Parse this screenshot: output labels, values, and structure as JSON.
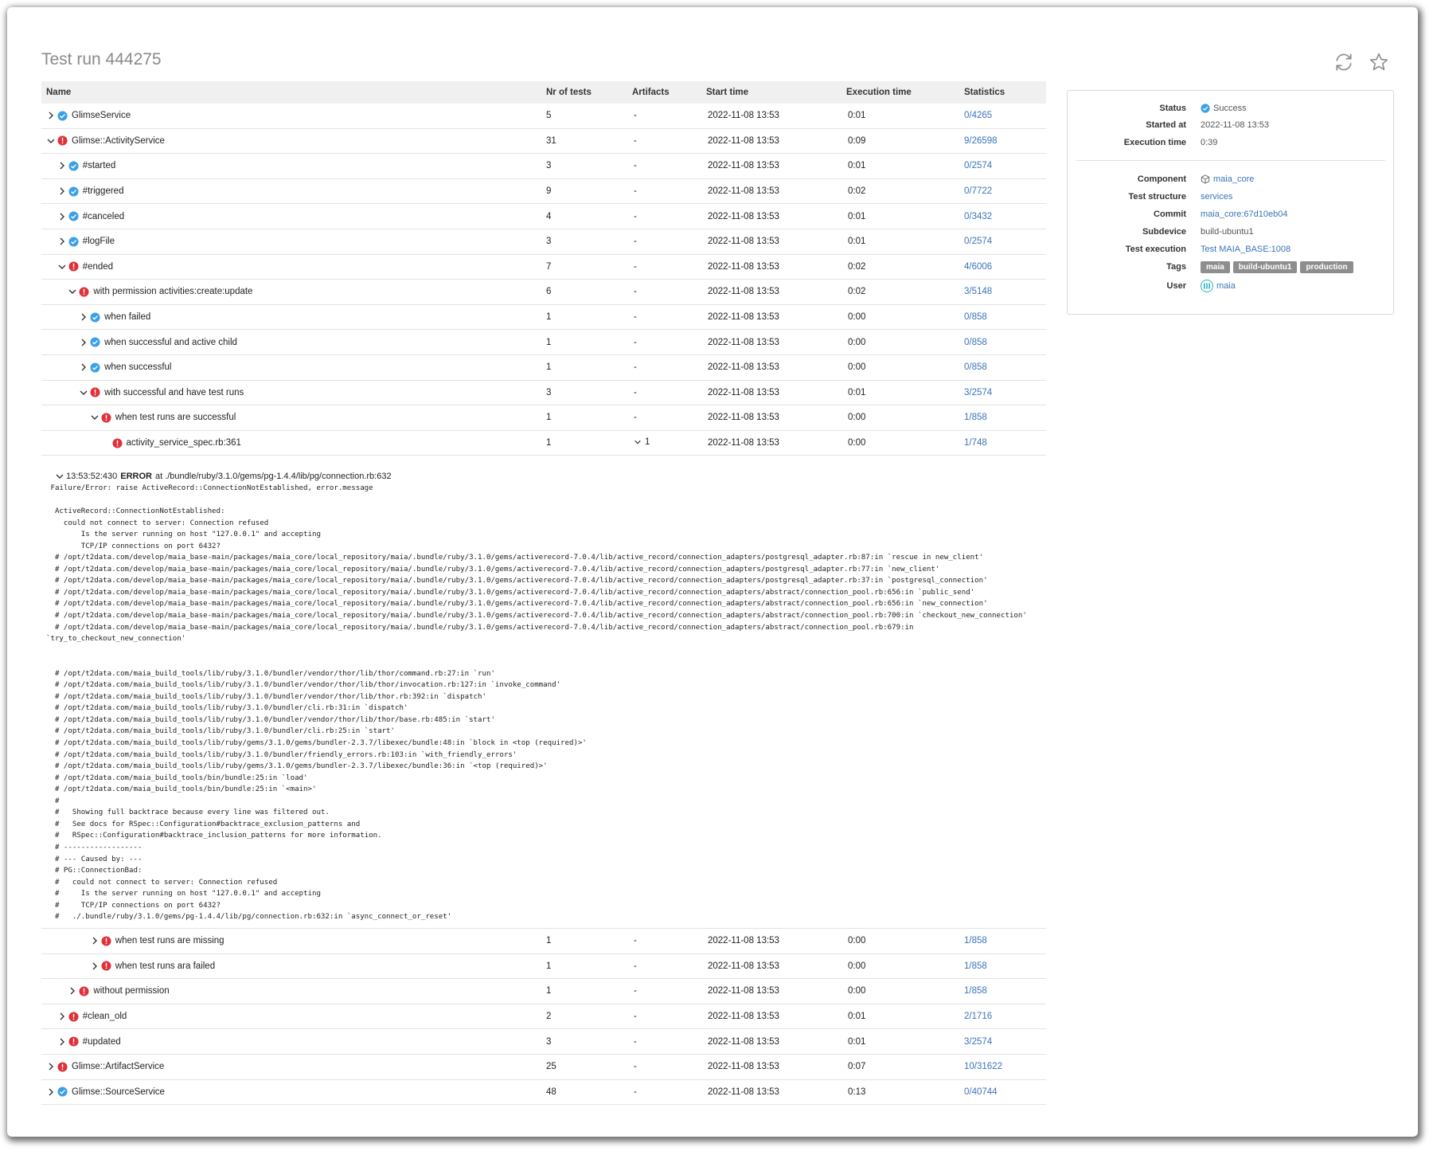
{
  "page": {
    "title": "Test run 444275"
  },
  "icons": {
    "refresh": "refresh-icon",
    "favorite": "star-icon"
  },
  "colors": {
    "success": "#3aa0e8",
    "error": "#e0313a",
    "link": "#3a74b8",
    "tag": "#8e8e8e"
  },
  "table": {
    "headers": {
      "name": "Name",
      "nr": "Nr of tests",
      "artifacts": "Artifacts",
      "start": "Start time",
      "exec": "Execution time",
      "stats": "Statistics"
    },
    "rows": [
      {
        "name": "GlimseService",
        "nr": "5",
        "artifacts": "-",
        "start": "2022-11-08 13:53",
        "exec": "0:01",
        "stats": "0/4265"
      },
      {
        "name": "Glimse::ActivityService",
        "nr": "31",
        "artifacts": "-",
        "start": "2022-11-08 13:53",
        "exec": "0:09",
        "stats": "9/26598"
      },
      {
        "name": "#started",
        "nr": "3",
        "artifacts": "-",
        "start": "2022-11-08 13:53",
        "exec": "0:01",
        "stats": "0/2574"
      },
      {
        "name": "#triggered",
        "nr": "9",
        "artifacts": "-",
        "start": "2022-11-08 13:53",
        "exec": "0:02",
        "stats": "0/7722"
      },
      {
        "name": "#canceled",
        "nr": "4",
        "artifacts": "-",
        "start": "2022-11-08 13:53",
        "exec": "0:01",
        "stats": "0/3432"
      },
      {
        "name": "#logFile",
        "nr": "3",
        "artifacts": "-",
        "start": "2022-11-08 13:53",
        "exec": "0:01",
        "stats": "0/2574"
      },
      {
        "name": "#ended",
        "nr": "7",
        "artifacts": "-",
        "start": "2022-11-08 13:53",
        "exec": "0:02",
        "stats": "4/6006"
      },
      {
        "name": "with permission activities:create:update",
        "nr": "6",
        "artifacts": "-",
        "start": "2022-11-08 13:53",
        "exec": "0:02",
        "stats": "3/5148"
      },
      {
        "name": "when failed",
        "nr": "1",
        "artifacts": "-",
        "start": "2022-11-08 13:53",
        "exec": "0:00",
        "stats": "0/858"
      },
      {
        "name": "when successful and active child",
        "nr": "1",
        "artifacts": "-",
        "start": "2022-11-08 13:53",
        "exec": "0:00",
        "stats": "0/858"
      },
      {
        "name": "when successful",
        "nr": "1",
        "artifacts": "-",
        "start": "2022-11-08 13:53",
        "exec": "0:00",
        "stats": "0/858"
      },
      {
        "name": "with successful and have test runs",
        "nr": "3",
        "artifacts": "-",
        "start": "2022-11-08 13:53",
        "exec": "0:01",
        "stats": "3/2574"
      },
      {
        "name": "when test runs are successful",
        "nr": "1",
        "artifacts": "-",
        "start": "2022-11-08 13:53",
        "exec": "0:00",
        "stats": "1/858"
      },
      {
        "name": "activity_service_spec.rb:361",
        "nr": "1",
        "artifacts": "1",
        "start": "2022-11-08 13:53",
        "exec": "0:00",
        "stats": "1/748"
      }
    ],
    "rows_after": [
      {
        "name": "when test runs are missing",
        "nr": "1",
        "artifacts": "-",
        "start": "2022-11-08 13:53",
        "exec": "0:00",
        "stats": "1/858"
      },
      {
        "name": "when test runs ara failed",
        "nr": "1",
        "artifacts": "-",
        "start": "2022-11-08 13:53",
        "exec": "0:00",
        "stats": "1/858"
      },
      {
        "name": "without permission",
        "nr": "1",
        "artifacts": "-",
        "start": "2022-11-08 13:53",
        "exec": "0:00",
        "stats": "1/858"
      },
      {
        "name": "#clean_old",
        "nr": "2",
        "artifacts": "-",
        "start": "2022-11-08 13:53",
        "exec": "0:01",
        "stats": "2/1716"
      },
      {
        "name": "#updated",
        "nr": "3",
        "artifacts": "-",
        "start": "2022-11-08 13:53",
        "exec": "0:01",
        "stats": "3/2574"
      },
      {
        "name": "Glimse::ArtifactService",
        "nr": "25",
        "artifacts": "-",
        "start": "2022-11-08 13:53",
        "exec": "0:07",
        "stats": "10/31622"
      },
      {
        "name": "Glimse::SourceService",
        "nr": "48",
        "artifacts": "-",
        "start": "2022-11-08 13:53",
        "exec": "0:13",
        "stats": "0/40744"
      }
    ]
  },
  "log": {
    "time": "13:53:52:430",
    "level": "ERROR",
    "location": "at ./bundle/ruby/3.1.0/gems/pg-1.4.4/lib/pg/connection.rb:632",
    "text": " Failure/Error: raise ActiveRecord::ConnectionNotEstablished, error.message\n\n  ActiveRecord::ConnectionNotEstablished:\n    could not connect to server: Connection refused\n        Is the server running on host \"127.0.0.1\" and accepting\n        TCP/IP connections on port 6432?\n  # /opt/t2data.com/develop/maia_base-main/packages/maia_core/local_repository/maia/.bundle/ruby/3.1.0/gems/activerecord-7.0.4/lib/active_record/connection_adapters/postgresql_adapter.rb:87:in `rescue in new_client'\n  # /opt/t2data.com/develop/maia_base-main/packages/maia_core/local_repository/maia/.bundle/ruby/3.1.0/gems/activerecord-7.0.4/lib/active_record/connection_adapters/postgresql_adapter.rb:77:in `new_client'\n  # /opt/t2data.com/develop/maia_base-main/packages/maia_core/local_repository/maia/.bundle/ruby/3.1.0/gems/activerecord-7.0.4/lib/active_record/connection_adapters/postgresql_adapter.rb:37:in `postgresql_connection'\n  # /opt/t2data.com/develop/maia_base-main/packages/maia_core/local_repository/maia/.bundle/ruby/3.1.0/gems/activerecord-7.0.4/lib/active_record/connection_adapters/abstract/connection_pool.rb:656:in `public_send'\n  # /opt/t2data.com/develop/maia_base-main/packages/maia_core/local_repository/maia/.bundle/ruby/3.1.0/gems/activerecord-7.0.4/lib/active_record/connection_adapters/abstract/connection_pool.rb:656:in `new_connection'\n  # /opt/t2data.com/develop/maia_base-main/packages/maia_core/local_repository/maia/.bundle/ruby/3.1.0/gems/activerecord-7.0.4/lib/active_record/connection_adapters/abstract/connection_pool.rb:700:in `checkout_new_connection'\n  # /opt/t2data.com/develop/maia_base-main/packages/maia_core/local_repository/maia/.bundle/ruby/3.1.0/gems/activerecord-7.0.4/lib/active_record/connection_adapters/abstract/connection_pool.rb:679:in\n`try_to_checkout_new_connection'\n\n\n  # /opt/t2data.com/maia_build_tools/lib/ruby/3.1.0/bundler/vendor/thor/lib/thor/command.rb:27:in `run'\n  # /opt/t2data.com/maia_build_tools/lib/ruby/3.1.0/bundler/vendor/thor/lib/thor/invocation.rb:127:in `invoke_command'\n  # /opt/t2data.com/maia_build_tools/lib/ruby/3.1.0/bundler/vendor/thor/lib/thor.rb:392:in `dispatch'\n  # /opt/t2data.com/maia_build_tools/lib/ruby/3.1.0/bundler/cli.rb:31:in `dispatch'\n  # /opt/t2data.com/maia_build_tools/lib/ruby/3.1.0/bundler/vendor/thor/lib/thor/base.rb:485:in `start'\n  # /opt/t2data.com/maia_build_tools/lib/ruby/3.1.0/bundler/cli.rb:25:in `start'\n  # /opt/t2data.com/maia_build_tools/lib/ruby/gems/3.1.0/gems/bundler-2.3.7/libexec/bundle:48:in `block in <top (required)>'\n  # /opt/t2data.com/maia_build_tools/lib/ruby/3.1.0/bundler/friendly_errors.rb:103:in `with_friendly_errors'\n  # /opt/t2data.com/maia_build_tools/lib/ruby/gems/3.1.0/gems/bundler-2.3.7/libexec/bundle:36:in `<top (required)>'\n  # /opt/t2data.com/maia_build_tools/bin/bundle:25:in `load'\n  # /opt/t2data.com/maia_build_tools/bin/bundle:25:in `<main>'\n  #\n  #   Showing full backtrace because every line was filtered out.\n  #   See docs for RSpec::Configuration#backtrace_exclusion_patterns and\n  #   RSpec::Configuration#backtrace_inclusion_patterns for more information.\n  # ------------------\n  # --- Caused by: ---\n  # PG::ConnectionBad:\n  #   could not connect to server: Connection refused\n  #     Is the server running on host \"127.0.0.1\" and accepting\n  #     TCP/IP connections on port 6432?\n  #   ./.bundle/ruby/3.1.0/gems/pg-1.4.4/lib/pg/connection.rb:632:in `async_connect_or_reset'"
  },
  "details": {
    "status": {
      "label": "Status",
      "value": "Success"
    },
    "started_at": {
      "label": "Started at",
      "value": "2022-11-08 13:53"
    },
    "execution_time": {
      "label": "Execution time",
      "value": "0:39"
    },
    "component": {
      "label": "Component",
      "value": "maia_core"
    },
    "test_structure": {
      "label": "Test structure",
      "value": "services"
    },
    "commit": {
      "label": "Commit",
      "value": "maia_core:67d10eb04"
    },
    "subdevice": {
      "label": "Subdevice",
      "value": "build-ubuntu1"
    },
    "test_execution": {
      "label": "Test execution",
      "value": "Test MAIA_BASE:1008"
    },
    "tags": {
      "label": "Tags",
      "items": [
        "maia",
        "build-ubuntu1",
        "production"
      ]
    },
    "user": {
      "label": "User",
      "value": "maia"
    }
  }
}
